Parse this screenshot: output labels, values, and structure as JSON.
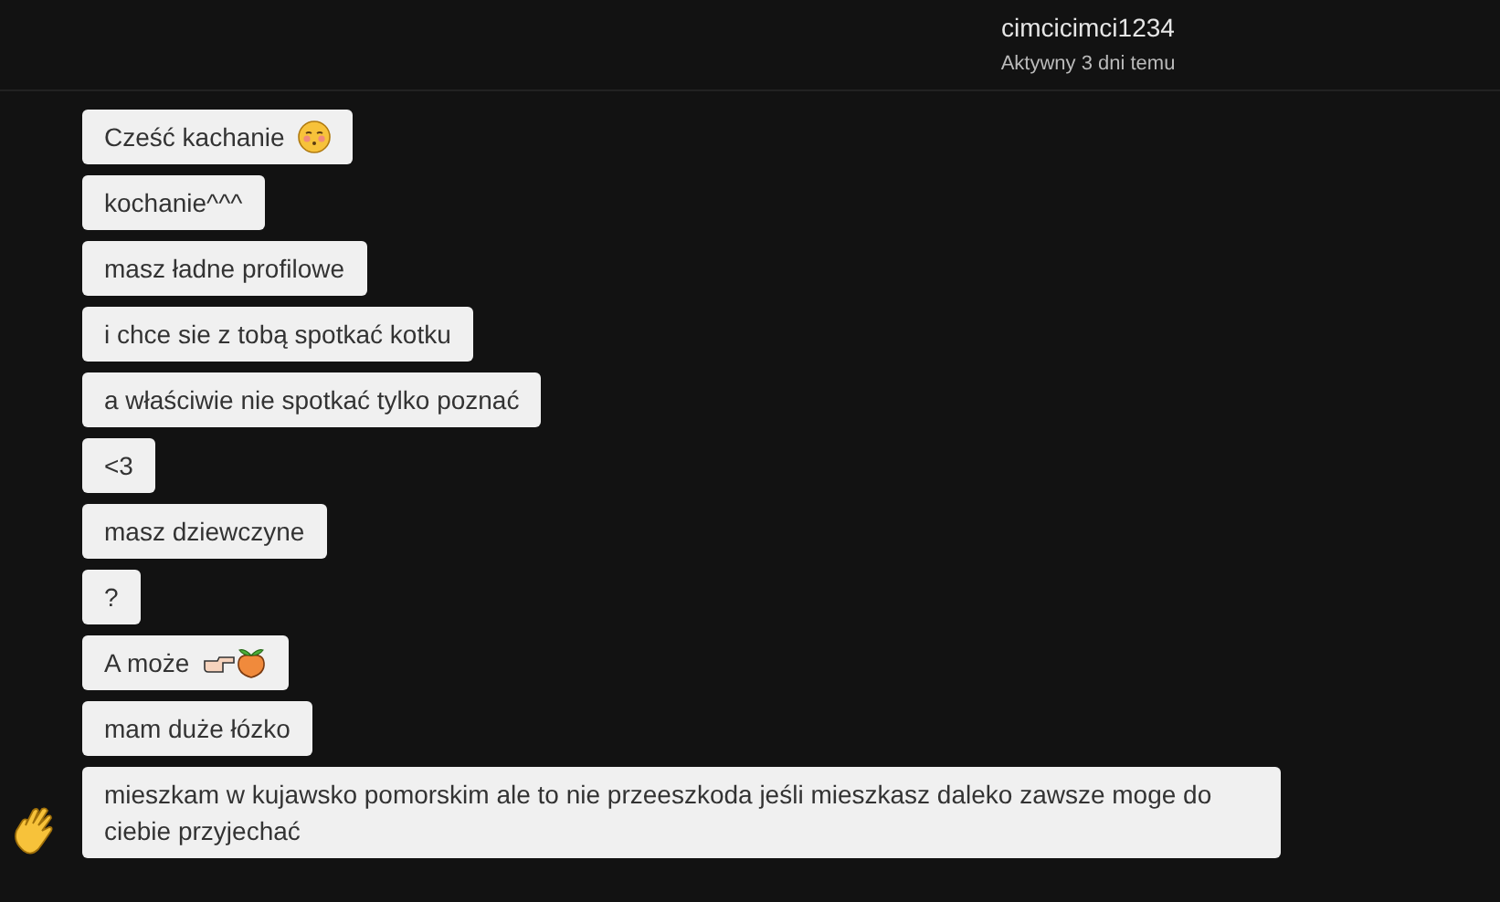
{
  "header": {
    "username": "cimcicimci1234",
    "status": "Aktywny 3 dni temu"
  },
  "messages": [
    {
      "text": "Cześć kachanie",
      "emojis": [
        {
          "kind": "kiss"
        }
      ]
    },
    {
      "text": "kochanie^^^"
    },
    {
      "text": "masz ładne profilowe"
    },
    {
      "text": "i chce sie z tobą spotkać kotku"
    },
    {
      "text": "a właściwie nie spotkać tylko poznać"
    },
    {
      "text": "<3"
    },
    {
      "text": "masz dziewczyne"
    },
    {
      "text": "?"
    },
    {
      "text": "A może",
      "emojis": [
        {
          "kind": "point"
        },
        {
          "kind": "peach"
        }
      ]
    },
    {
      "text": "mam duże łózko"
    },
    {
      "text": "mieszkam w kujawsko pomorskim ale to nie przeeszkoda jeśli mieszkasz daleko zawsze moge do ciebie przyjechać",
      "reaction": {
        "kind": "wave"
      }
    }
  ]
}
